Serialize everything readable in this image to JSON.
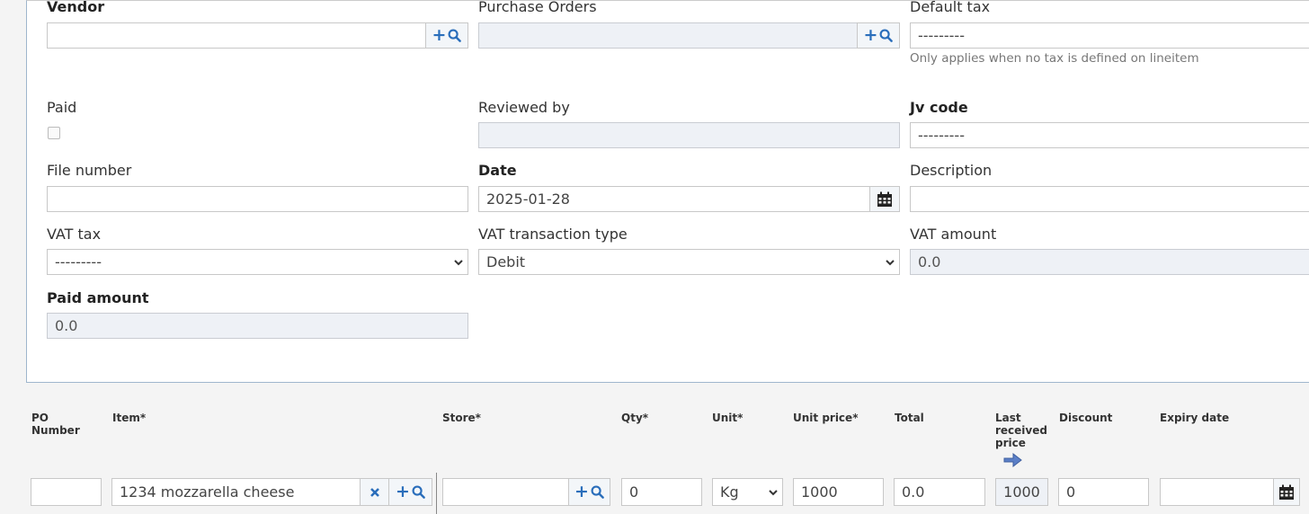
{
  "form": {
    "vendor": {
      "label": "Vendor",
      "value": ""
    },
    "purchase_orders": {
      "label": "Purchase Orders",
      "value": ""
    },
    "default_tax": {
      "label": "Default tax",
      "value": "---------",
      "help": "Only applies when no tax is defined on lineitem"
    },
    "paid": {
      "label": "Paid",
      "checked": false
    },
    "reviewed_by": {
      "label": "Reviewed by",
      "value": ""
    },
    "jv_code": {
      "label": "Jv code",
      "value": "---------"
    },
    "file_number": {
      "label": "File number",
      "value": ""
    },
    "date": {
      "label": "Date",
      "value": "2025-01-28"
    },
    "description": {
      "label": "Description",
      "value": ""
    },
    "vat_tax": {
      "label": "VAT tax",
      "value": "---------"
    },
    "vat_transaction_type": {
      "label": "VAT transaction type",
      "value": "Debit"
    },
    "vat_amount": {
      "label": "VAT amount",
      "value": "0.0"
    },
    "paid_amount": {
      "label": "Paid amount",
      "value": "0.0"
    }
  },
  "line_items": {
    "headers": {
      "po_number": "PO Number",
      "item": "Item*",
      "store": "Store*",
      "qty": "Qty*",
      "unit": "Unit*",
      "unit_price": "Unit price*",
      "total": "Total",
      "last_received_price": "Last received price",
      "discount": "Discount",
      "expiry_date": "Expiry date"
    },
    "rows": [
      {
        "po_number": "",
        "item": "1234 mozzarella cheese",
        "store": "",
        "qty": "0",
        "unit": "Kg",
        "unit_price": "1000",
        "total": "0.0",
        "last_received_price": "1000",
        "discount": "0",
        "expiry_date": ""
      }
    ]
  },
  "icons": {
    "add": "plus-icon",
    "search": "search-icon",
    "clear": "close-icon",
    "calendar": "calendar-icon",
    "arrow": "arrow-right-icon",
    "select": "chevron-down-icon"
  },
  "colors": {
    "accent": "#2a6ebb",
    "readonly_bg": "#eef1f6",
    "panel_border": "#9fb6cd"
  }
}
